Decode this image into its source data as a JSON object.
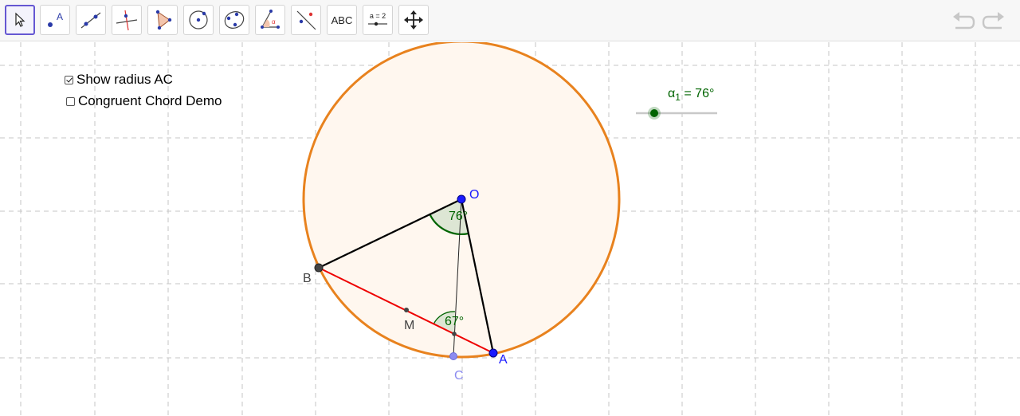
{
  "toolbar": {
    "tools": [
      {
        "name": "move-tool"
      },
      {
        "name": "point-tool",
        "label": "A"
      },
      {
        "name": "line-tool"
      },
      {
        "name": "perpendicular-line-tool"
      },
      {
        "name": "polygon-tool"
      },
      {
        "name": "circle-center-point-tool"
      },
      {
        "name": "circle-three-points-tool"
      },
      {
        "name": "angle-tool"
      },
      {
        "name": "reflect-tool"
      },
      {
        "name": "text-tool",
        "label": "ABC"
      },
      {
        "name": "slider-tool",
        "label": "a = 2"
      },
      {
        "name": "move-graphics-view-tool"
      }
    ]
  },
  "checkboxes": {
    "show_radius": {
      "label": "Show radius AC",
      "checked": true
    },
    "congruent_chord": {
      "label": "Congruent Chord Demo",
      "checked": false
    }
  },
  "slider": {
    "name": "α",
    "subscript": "1",
    "value_text": "= 76°",
    "value": 76
  },
  "points": {
    "O": "O",
    "A": "A",
    "B": "B",
    "C": "C",
    "M": "M"
  },
  "angles": {
    "central": "76°",
    "inscribed": "67°"
  },
  "colors": {
    "circle": "#e8821e",
    "circle_fill": "#fff7ef",
    "chord": "#ee0000",
    "point_blue": "#1a1aff",
    "point_gray": "#444444",
    "angle_green": "#006400",
    "point_c": "#8b8bf0",
    "toolbar_active": "#6557d2"
  }
}
